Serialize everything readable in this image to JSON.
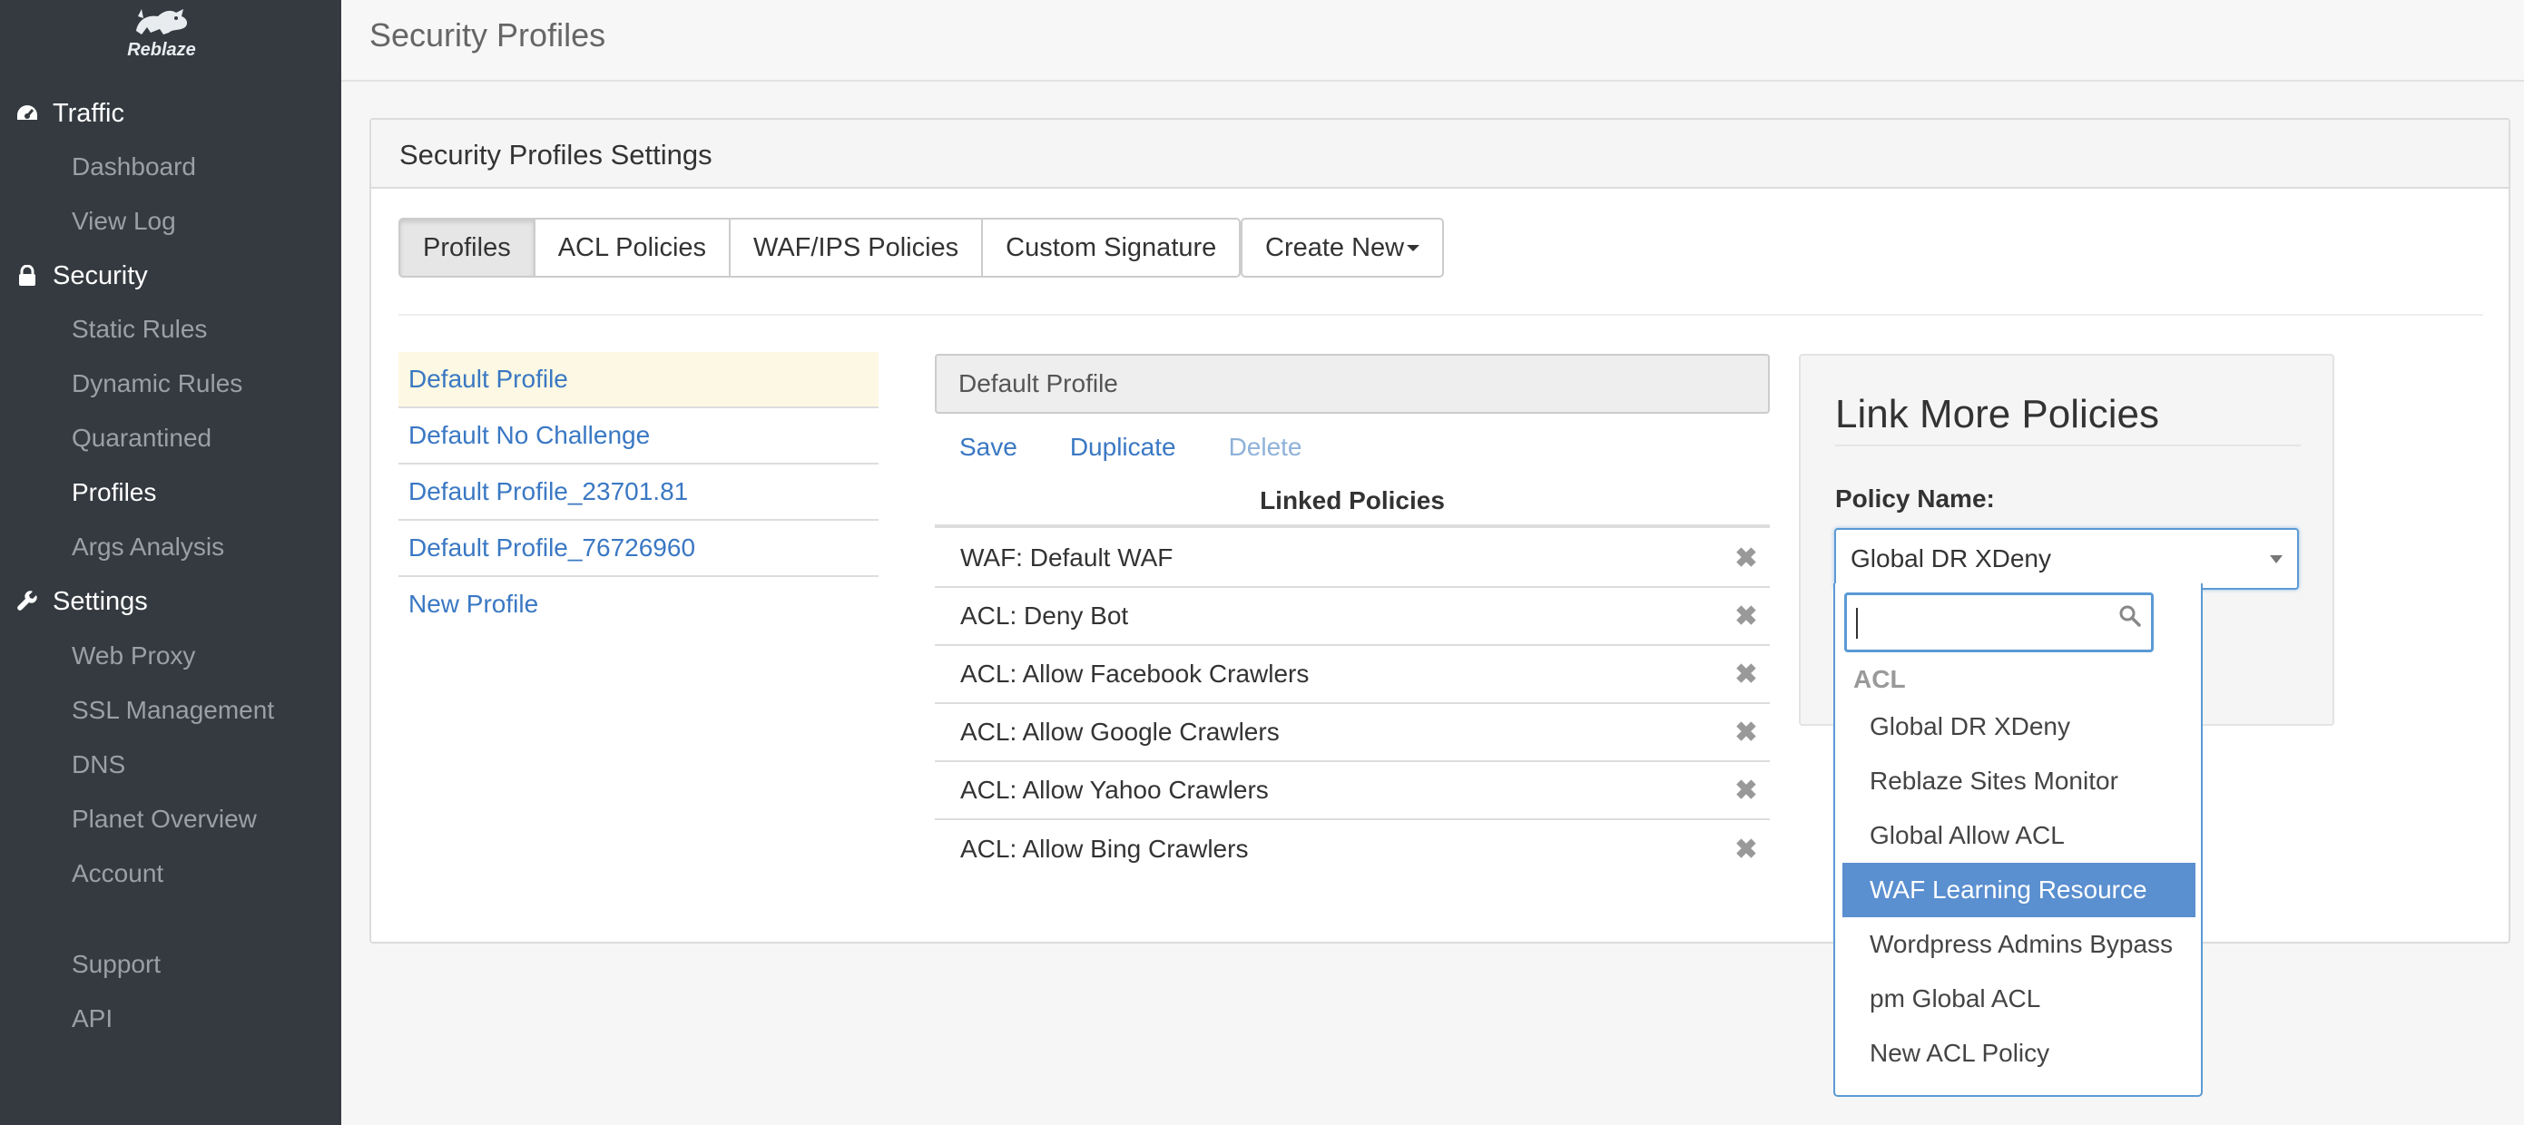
{
  "app": {
    "logo_text": "Reblaze"
  },
  "sidebar": {
    "sections": [
      {
        "label": "Traffic",
        "icon": "dashboard-gauge-icon"
      },
      {
        "label": "Security",
        "icon": "lock-icon"
      },
      {
        "label": "Settings",
        "icon": "wrench-icon"
      }
    ],
    "traffic_items": [
      "Dashboard",
      "View Log"
    ],
    "security_items": [
      "Static Rules",
      "Dynamic Rules",
      "Quarantined",
      "Profiles",
      "Args Analysis"
    ],
    "settings_items": [
      "Web Proxy",
      "SSL Management",
      "DNS",
      "Planet Overview",
      "Account"
    ],
    "footer_items": [
      "Support",
      "API"
    ],
    "active_item": "Profiles"
  },
  "header": {
    "title": "Security Profiles"
  },
  "panel": {
    "title": "Security Profiles Settings",
    "tabs": [
      "Profiles",
      "ACL Policies",
      "WAF/IPS Policies",
      "Custom Signature"
    ],
    "active_tab": "Profiles",
    "create_new_label": "Create New"
  },
  "profiles": {
    "items": [
      "Default Profile",
      "Default No Challenge",
      "Default Profile_23701.81",
      "Default Profile_76726960",
      "New Profile"
    ],
    "selected": "Default Profile"
  },
  "editor": {
    "profile_name": "Default Profile",
    "actions": {
      "save": "Save",
      "duplicate": "Duplicate",
      "delete": "Delete"
    },
    "linked_header": "Linked Policies",
    "linked_policies": [
      "WAF: Default WAF",
      "ACL: Deny Bot",
      "ACL: Allow Facebook Crawlers",
      "ACL: Allow Google Crawlers",
      "ACL: Allow Yahoo Crawlers",
      "ACL: Allow Bing Crawlers"
    ],
    "remove_glyph": "✖"
  },
  "link_more": {
    "title": "Link More Policies",
    "policy_label": "Policy Name:",
    "selected_value": "Global DR XDeny",
    "dropdown": {
      "search_value": "",
      "group_label": "ACL",
      "options": [
        "Global DR XDeny",
        "Reblaze Sites Monitor",
        "Global Allow ACL",
        "WAF Learning Resource",
        "Wordpress Admins Bypass",
        "pm Global ACL",
        "New ACL Policy"
      ],
      "highlighted": "WAF Learning Resource"
    }
  },
  "colors": {
    "sidebar_bg": "#343a40",
    "link_blue": "#3a78c3",
    "highlight_blue": "#5a8fd0",
    "selected_row_bg": "#fcf8e3"
  }
}
